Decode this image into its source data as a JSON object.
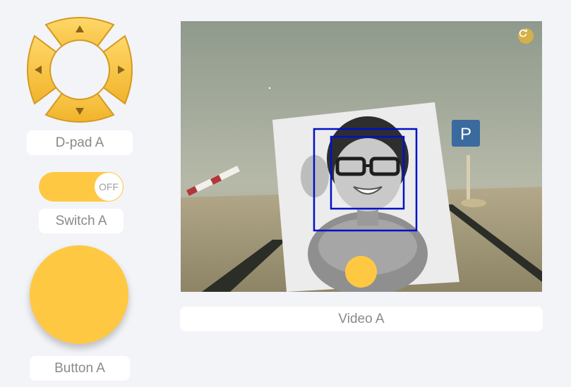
{
  "dpad": {
    "label": "D-pad A",
    "up_icon": "up-arrow-icon",
    "down_icon": "down-arrow-icon",
    "left_icon": "left-arrow-icon",
    "right_icon": "right-arrow-icon"
  },
  "switch": {
    "label": "Switch A",
    "state_text": "OFF"
  },
  "button": {
    "label": "Button A"
  },
  "video": {
    "label": "Video A",
    "refresh_icon": "refresh-icon",
    "sign_text": "P"
  },
  "colors": {
    "accent": "#ffc843",
    "background": "#f3f4f8",
    "detection_box": "#0010c8",
    "label_text": "#8a8a8a"
  }
}
